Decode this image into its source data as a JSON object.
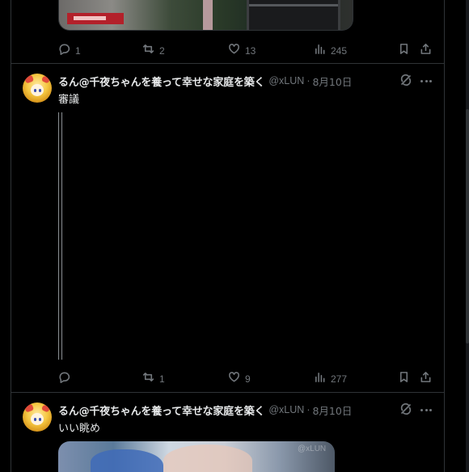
{
  "tweets": [
    {
      "actions": {
        "reply": "1",
        "retweet": "2",
        "like": "13",
        "views": "245"
      }
    },
    {
      "author": {
        "display_name": "るん@千夜ちゃんを養って幸せな家庭を築く",
        "handle": "@xLUN",
        "date": "8月10日"
      },
      "separator": "·",
      "text": "審議",
      "actions": {
        "reply": "",
        "retweet": "1",
        "like": "9",
        "views": "277"
      }
    },
    {
      "author": {
        "display_name": "るん@千夜ちゃんを養って幸せな家庭を築く",
        "handle": "@xLUN",
        "date": "8月10日"
      },
      "separator": "·",
      "text": "いい眺め",
      "image_watermark": "@xLUN"
    }
  ]
}
